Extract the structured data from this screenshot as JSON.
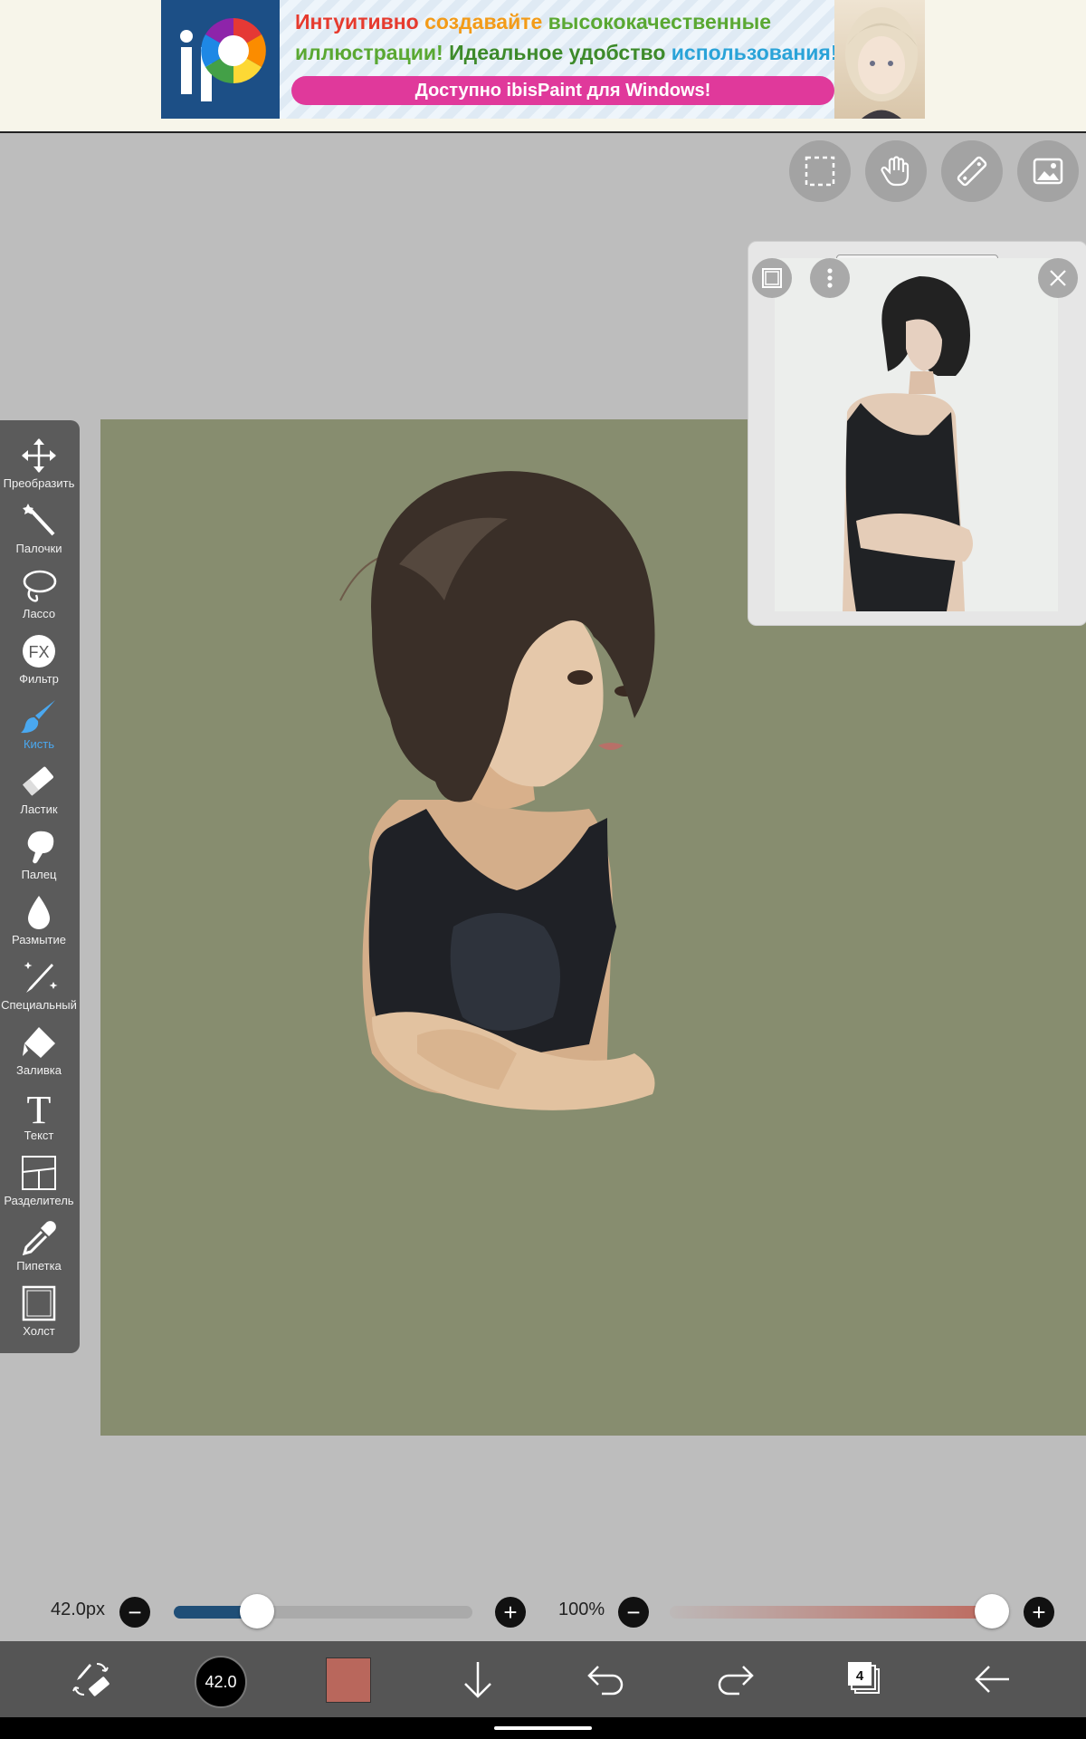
{
  "ad": {
    "line1": [
      {
        "text": "Интуитивно ",
        "color": "red"
      },
      {
        "text": "создавайте ",
        "color": "orange"
      },
      {
        "text": "высококачественные",
        "color": "green"
      }
    ],
    "line2": [
      {
        "text": "иллюстрации! ",
        "color": "green"
      },
      {
        "text": "Идеальное удобство ",
        "color": "darkgreen"
      },
      {
        "text": "использования!",
        "color": "blue"
      }
    ],
    "cta": "Доступно ibisPaint для Windows!"
  },
  "top_tools": [
    "selection-icon",
    "hand-icon",
    "ruler-icon",
    "reference-image-icon"
  ],
  "toolbar": {
    "active": "Кисть",
    "items": [
      {
        "label": "Преобразить",
        "icon": "move-arrows-icon"
      },
      {
        "label": "Палочки",
        "icon": "magic-wand-icon"
      },
      {
        "label": "Лассо",
        "icon": "lasso-icon"
      },
      {
        "label": "Фильтр",
        "icon": "fx-icon"
      },
      {
        "label": "Кисть",
        "icon": "brush-icon"
      },
      {
        "label": "Ластик",
        "icon": "eraser-icon"
      },
      {
        "label": "Палец",
        "icon": "finger-icon"
      },
      {
        "label": "Размытие",
        "icon": "blur-drop-icon"
      },
      {
        "label": "Специальный",
        "icon": "special-pen-icon"
      },
      {
        "label": "Заливка",
        "icon": "fill-bucket-icon"
      },
      {
        "label": "Текст",
        "icon": "text-icon"
      },
      {
        "label": "Разделитель",
        "icon": "frame-divider-icon"
      },
      {
        "label": "Пипетка",
        "icon": "eyedropper-icon"
      },
      {
        "label": "Холст",
        "icon": "canvas-icon"
      }
    ]
  },
  "canvas": {
    "background": "#878d6f"
  },
  "brush": {
    "size_label": "42.0px",
    "size_fraction": 0.28,
    "minus": "−",
    "plus": "+"
  },
  "opacity": {
    "label": "100%",
    "value_fraction": 1.0,
    "minus": "−",
    "plus": "+"
  },
  "bottom_bar": {
    "brush_size_badge": "42.0",
    "current_color": "#b9675c",
    "layers_count": "4",
    "icons": [
      "brush-eraser-swap-icon",
      "move-down-icon",
      "undo-icon",
      "redo-icon",
      "layers-icon",
      "back-arrow-icon"
    ]
  }
}
